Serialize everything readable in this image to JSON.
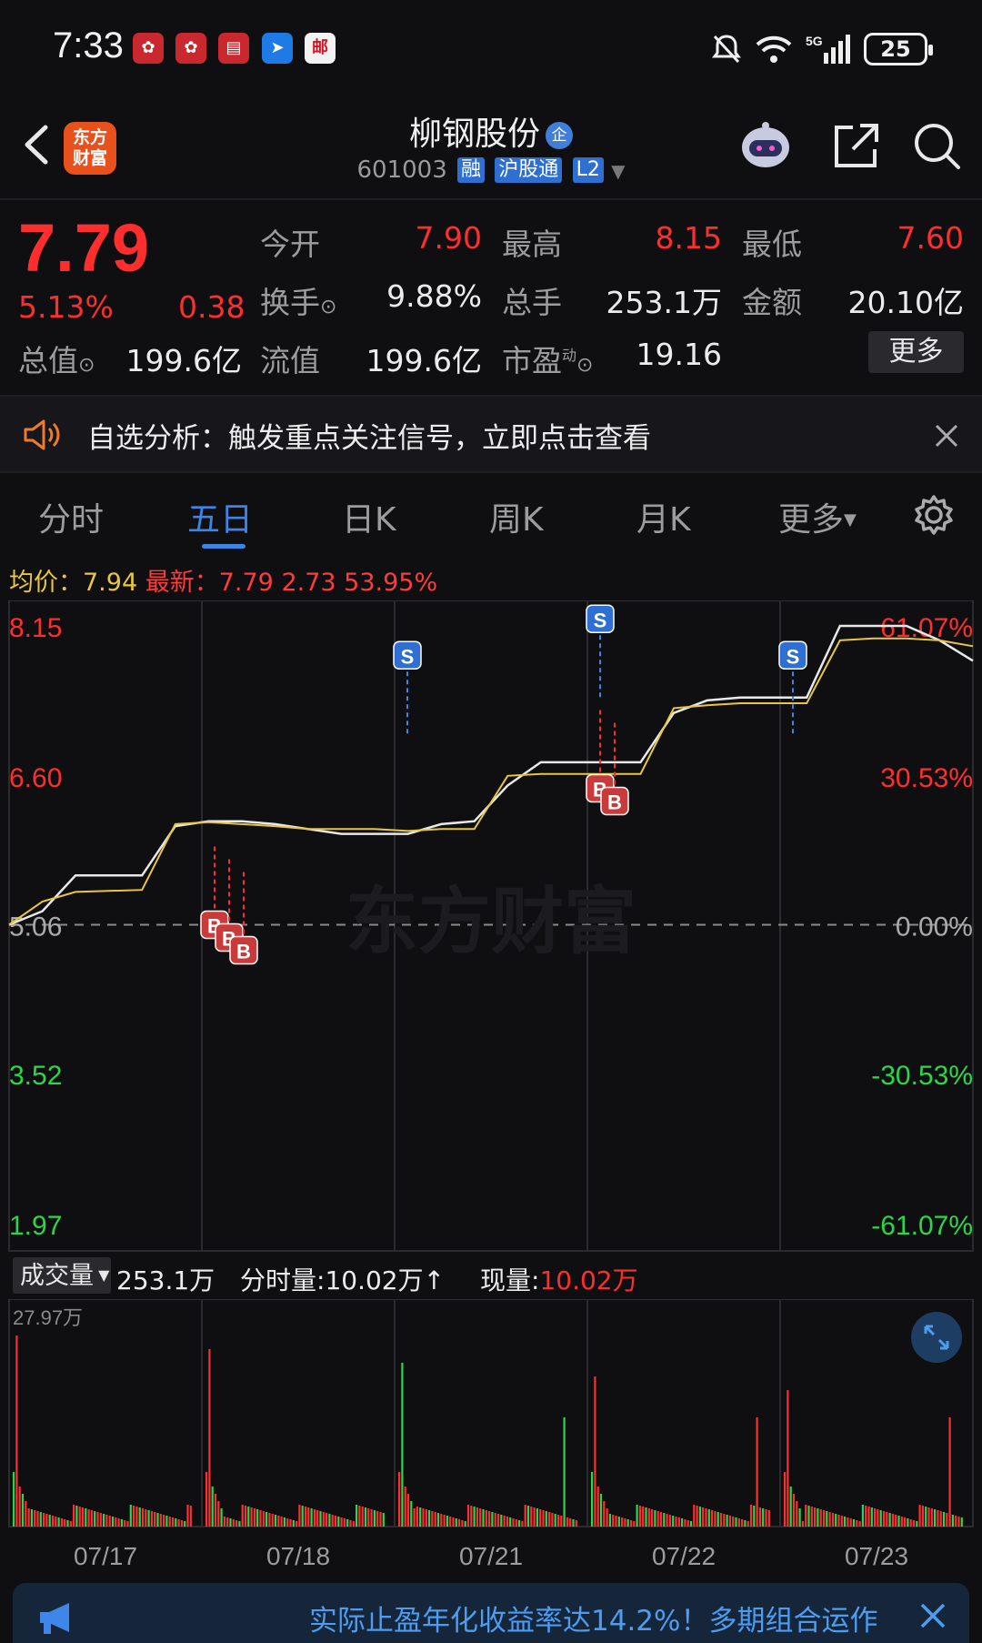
{
  "status_bar": {
    "time": "7:33",
    "app_icons": [
      "huawei-icon",
      "huawei-icon",
      "book-icon",
      "arrow-app-icon",
      "post-app-icon"
    ],
    "post_label": "邮",
    "network": "5G",
    "battery": "25"
  },
  "header": {
    "logo_line1": "东方",
    "logo_line2": "财富",
    "title": "柳钢股份",
    "title_badge": "企",
    "code": "601003",
    "tags": [
      "融",
      "沪股通",
      "L2"
    ]
  },
  "quote": {
    "price": "7.79",
    "pct_change": "5.13%",
    "change": "0.38",
    "labels": {
      "open": "今开",
      "high": "最高",
      "low": "最低",
      "turnover": "换手",
      "volume": "总手",
      "amount": "金额",
      "total_cap": "总值",
      "float_cap": "流值",
      "pe": "市盈",
      "pe_sup": "动"
    },
    "values": {
      "open": "7.90",
      "high": "8.15",
      "low": "7.60",
      "turnover": "9.88%",
      "volume": "253.1万",
      "amount": "20.10亿",
      "total_cap": "199.6亿",
      "float_cap": "199.6亿",
      "pe": "19.16"
    },
    "more": "更多"
  },
  "banner": {
    "text": "自选分析：触发重点关注信号，立即点击查看"
  },
  "tabs": [
    "分时",
    "五日",
    "日K",
    "周K",
    "月K",
    "更多"
  ],
  "active_tab": 1,
  "chart_info": {
    "avg_label": "均价：",
    "avg_value": "7.94",
    "latest_label": "最新：",
    "latest_value": "7.79",
    "latest_change": "2.73",
    "latest_pct": "53.95%"
  },
  "chart_data": {
    "type": "line",
    "title": "",
    "x_dates": [
      "07/17",
      "07/18",
      "07/21",
      "07/22",
      "07/23"
    ],
    "y_left_ticks": [
      "8.15",
      "6.60",
      "5.06",
      "3.52",
      "1.97"
    ],
    "y_right_ticks": [
      "61.07%",
      "30.53%",
      "0.00%",
      "-30.53%",
      "-61.07%"
    ],
    "ylim": [
      1.97,
      8.15
    ],
    "base_price": 5.06,
    "series": [
      {
        "values": [
          5.06,
          5.2,
          5.57,
          5.57,
          5.57,
          6.08,
          6.13,
          6.13,
          6.1,
          6.05,
          6.0,
          6.0,
          6.0,
          6.1,
          6.13,
          6.5,
          6.74,
          6.74,
          6.74,
          6.74,
          7.25,
          7.38,
          7.41,
          7.41,
          7.41,
          8.15,
          8.15,
          8.15,
          8.0,
          7.79
        ]
      },
      {
        "values": [
          5.06,
          5.3,
          5.4,
          5.41,
          5.42,
          6.1,
          6.12,
          6.1,
          6.08,
          6.05,
          6.05,
          6.05,
          6.03,
          6.05,
          6.05,
          6.6,
          6.62,
          6.62,
          6.62,
          6.62,
          7.3,
          7.33,
          7.35,
          7.35,
          7.35,
          8.0,
          8.02,
          8.02,
          8.0,
          7.94
        ]
      }
    ],
    "signals": [
      {
        "type": "B",
        "day": 1
      },
      {
        "type": "B",
        "day": 1
      },
      {
        "type": "B",
        "day": 1
      },
      {
        "type": "S",
        "day": 2
      },
      {
        "type": "S",
        "day": 3
      },
      {
        "type": "B",
        "day": 3
      },
      {
        "type": "B",
        "day": 3
      },
      {
        "type": "S",
        "day": 4
      }
    ],
    "watermark": "东方财富"
  },
  "volume": {
    "selector": "成交量",
    "total": "253.1万",
    "bar_label": "分时量:",
    "bar_value": "10.02万",
    "bar_arrow": "↑",
    "current_label": "现量:",
    "current_value": "10.02万",
    "max_label": "27.97万"
  },
  "bottom_banner": {
    "text": "实际止盈年化收益率达14.2%！多期组合运作"
  },
  "colors": {
    "up": "#ff2e2e",
    "down": "#2bd64a",
    "price_line": "#e8e8e8",
    "avg_line": "#e8c640",
    "accent": "#3c84e6"
  }
}
